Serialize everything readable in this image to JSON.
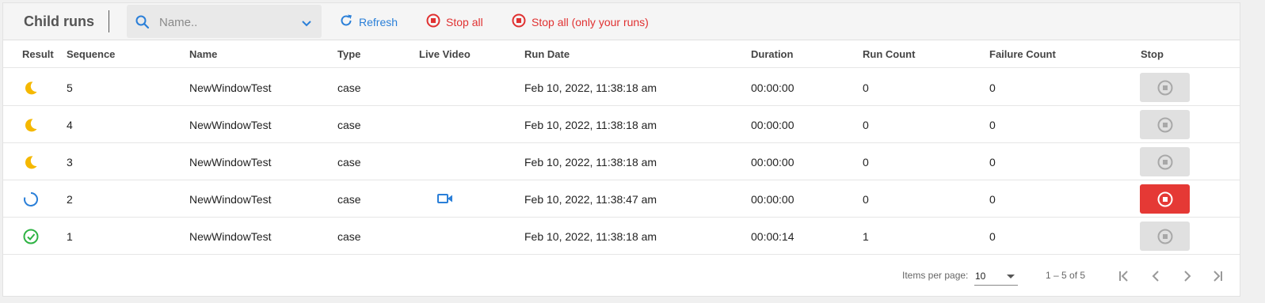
{
  "header": {
    "title": "Child runs",
    "search_placeholder": "Name..",
    "refresh_label": "Refresh",
    "stop_all_label": "Stop all",
    "stop_all_mine_label": "Stop all (only your runs)"
  },
  "columns": [
    "Result",
    "Sequence",
    "Name",
    "Type",
    "Live Video",
    "Run Date",
    "Duration",
    "Run Count",
    "Failure Count",
    "Stop"
  ],
  "rows": [
    {
      "result": "pending-moon-icon",
      "sequence": "5",
      "name": "NewWindowTest",
      "type": "case",
      "live_video": false,
      "run_date": "Feb 10, 2022, 11:38:18 am",
      "duration": "00:00:00",
      "run_count": "0",
      "failure_count": "0",
      "stop_active": false
    },
    {
      "result": "pending-moon-icon",
      "sequence": "4",
      "name": "NewWindowTest",
      "type": "case",
      "live_video": false,
      "run_date": "Feb 10, 2022, 11:38:18 am",
      "duration": "00:00:00",
      "run_count": "0",
      "failure_count": "0",
      "stop_active": false
    },
    {
      "result": "pending-moon-icon",
      "sequence": "3",
      "name": "NewWindowTest",
      "type": "case",
      "live_video": false,
      "run_date": "Feb 10, 2022, 11:38:18 am",
      "duration": "00:00:00",
      "run_count": "0",
      "failure_count": "0",
      "stop_active": false
    },
    {
      "result": "running-spinner-icon",
      "sequence": "2",
      "name": "NewWindowTest",
      "type": "case",
      "live_video": true,
      "run_date": "Feb 10, 2022, 11:38:47 am",
      "duration": "00:00:00",
      "run_count": "0",
      "failure_count": "0",
      "stop_active": true
    },
    {
      "result": "success-check-icon",
      "sequence": "1",
      "name": "NewWindowTest",
      "type": "case",
      "live_video": false,
      "run_date": "Feb 10, 2022, 11:38:18 am",
      "duration": "00:00:14",
      "run_count": "1",
      "failure_count": "0",
      "stop_active": false
    }
  ],
  "paginator": {
    "items_per_page_label": "Items per page:",
    "items_per_page_value": "10",
    "range_label": "1 – 5 of 5"
  },
  "colors": {
    "accent_blue": "#2a7fd8",
    "danger_red": "#e53935",
    "pending_yellow": "#f5b800",
    "success_green": "#2fb344"
  }
}
